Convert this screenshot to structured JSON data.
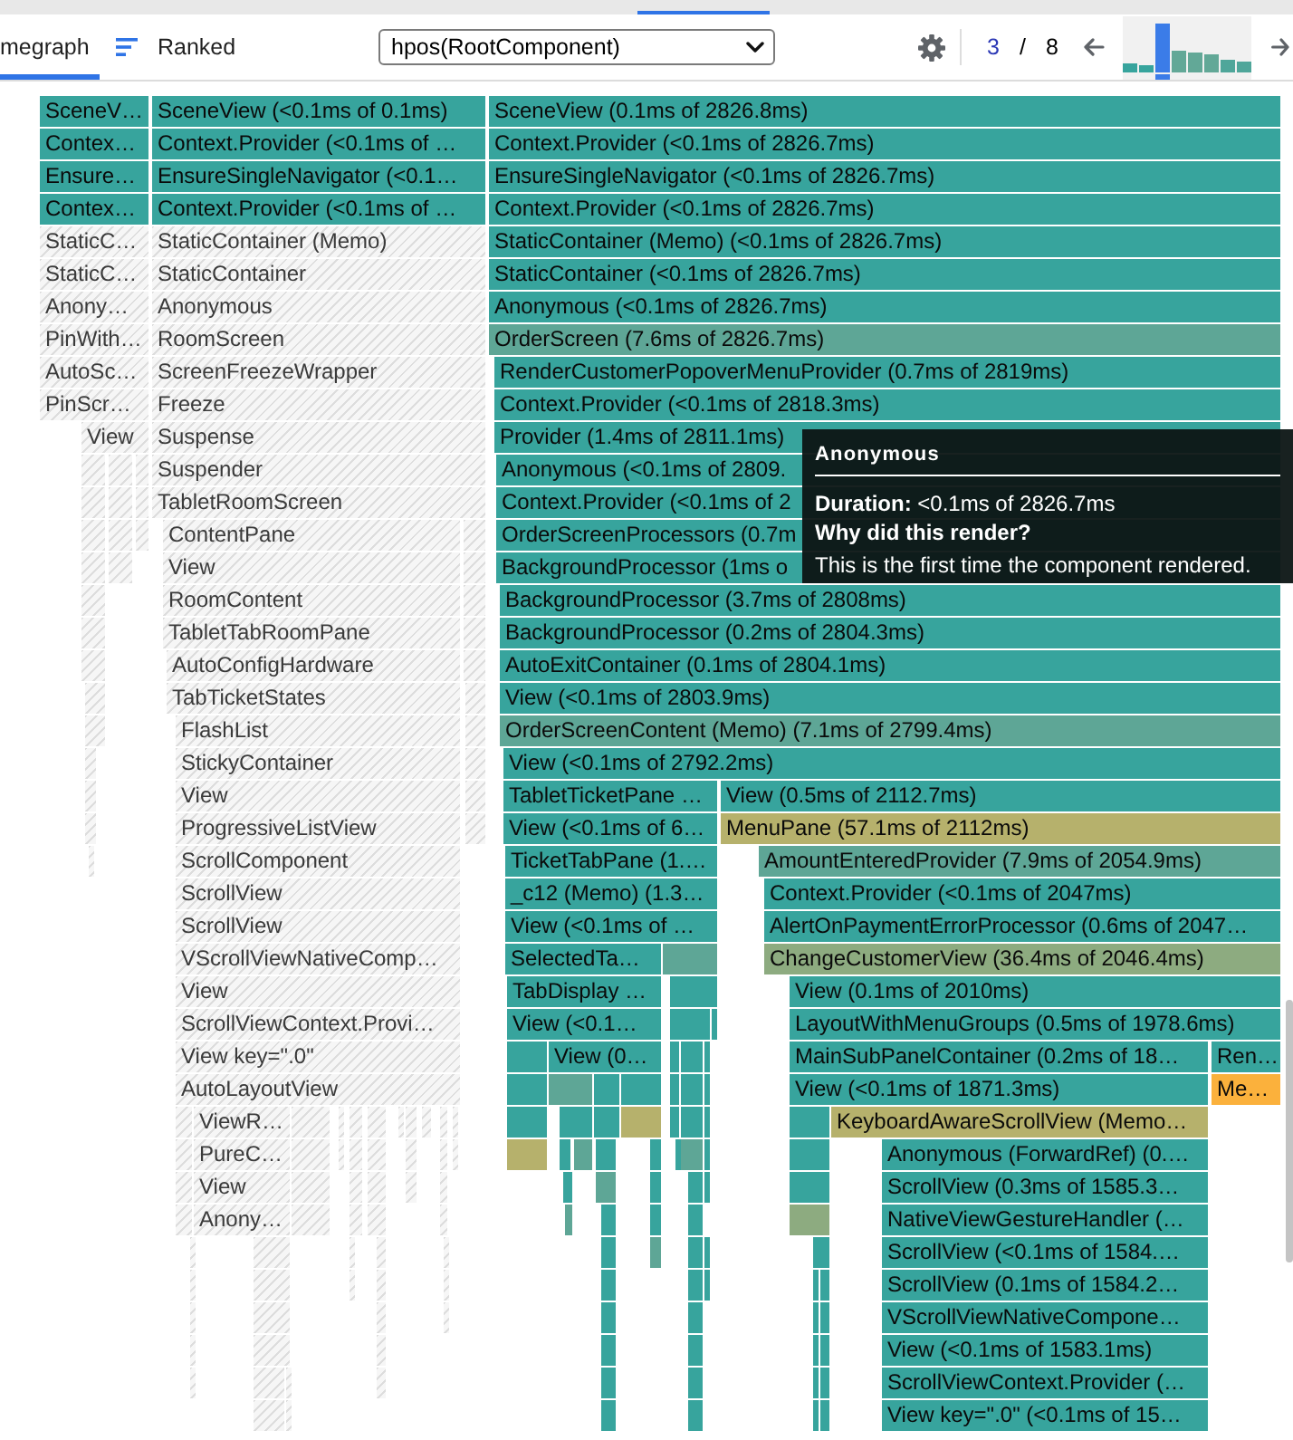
{
  "toolbar": {
    "tabs": [
      {
        "kind": "flamegraph",
        "label": "megraph",
        "selected": true
      },
      {
        "kind": "ranked",
        "label": "Ranked",
        "selected": false
      }
    ],
    "root_select": {
      "value": "hpos(RootComponent)"
    },
    "commit_nav": {
      "current": "3",
      "separator": "/",
      "total": "8"
    },
    "commits": [
      {
        "selected": false,
        "color": "#37a49d"
      },
      {
        "selected": false,
        "color": "#37a49d"
      },
      {
        "selected": true
      },
      {
        "selected": false,
        "color": "#62a897"
      },
      {
        "selected": false,
        "color": "#62a897"
      },
      {
        "selected": false,
        "color": "#62a897"
      },
      {
        "selected": false,
        "color": "#4fa69a"
      },
      {
        "selected": false,
        "color": "#4fa69a"
      }
    ]
  },
  "flamegraph": {
    "rows": [
      {
        "bars": [
          {
            "label": "SceneV…",
            "rendered": true,
            "color": "#37a49d"
          },
          {
            "label": "SceneView (<0.1ms of 0.1ms)",
            "rendered": true,
            "color": "#37a49d"
          },
          {
            "label": "SceneView (0.1ms of 2826.8ms)",
            "rendered": true,
            "color": "#37a49d"
          }
        ]
      },
      {
        "bars": [
          {
            "label": "Contex…",
            "rendered": true,
            "color": "#37a49d"
          },
          {
            "label": "Context.Provider (<0.1ms of …",
            "rendered": true,
            "color": "#37a49d"
          },
          {
            "label": "Context.Provider (<0.1ms of 2826.7ms)",
            "rendered": true,
            "color": "#37a49d"
          }
        ]
      },
      {
        "bars": [
          {
            "label": "Ensure…",
            "rendered": true,
            "color": "#37a49d"
          },
          {
            "label": "EnsureSingleNavigator (<0.1…",
            "rendered": true,
            "color": "#37a49d"
          },
          {
            "label": "EnsureSingleNavigator (<0.1ms of 2826.7ms)",
            "rendered": true,
            "color": "#37a49d"
          }
        ]
      },
      {
        "bars": [
          {
            "label": "Contex…",
            "rendered": true,
            "color": "#37a49d"
          },
          {
            "label": "Context.Provider (<0.1ms of …",
            "rendered": true,
            "color": "#37a49d"
          },
          {
            "label": "Context.Provider (<0.1ms of 2826.7ms)",
            "rendered": true,
            "color": "#37a49d"
          }
        ]
      },
      {
        "bars": [
          {
            "label": "StaticC…",
            "rendered": false
          },
          {
            "label": "StaticContainer (Memo)",
            "rendered": false
          },
          {
            "label": "StaticContainer (Memo) (<0.1ms of 2826.7ms)",
            "rendered": true,
            "color": "#37a49d"
          }
        ]
      },
      {
        "bars": [
          {
            "label": "StaticC…",
            "rendered": false
          },
          {
            "label": "StaticContainer",
            "rendered": false
          },
          {
            "label": "StaticContainer (<0.1ms of 2826.7ms)",
            "rendered": true,
            "color": "#37a49d"
          }
        ]
      },
      {
        "bars": [
          {
            "label": "Anony…",
            "rendered": false
          },
          {
            "label": "Anonymous",
            "rendered": false
          },
          {
            "label": "Anonymous (<0.1ms of 2826.7ms)",
            "rendered": true,
            "color": "#37a49d"
          }
        ]
      },
      {
        "bars": [
          {
            "label": "PinWith…",
            "rendered": false
          },
          {
            "label": "RoomScreen",
            "rendered": false
          },
          {
            "label": "OrderScreen (7.6ms of 2826.7ms)",
            "rendered": true,
            "color": "#5ea696"
          }
        ]
      },
      {
        "bars": [
          {
            "label": "AutoSc…",
            "rendered": false
          },
          {
            "label": "ScreenFreezeWrapper",
            "rendered": false
          },
          {
            "label": "RenderCustomerPopoverMenuProvider (0.7ms of 2819ms)",
            "rendered": true,
            "color": "#37a49d"
          }
        ]
      },
      {
        "bars": [
          {
            "label": "PinScr…",
            "rendered": false
          },
          {
            "label": "Freeze",
            "rendered": false
          },
          {
            "label": "Context.Provider (<0.1ms of 2818.3ms)",
            "rendered": true,
            "color": "#37a49d"
          }
        ]
      },
      {
        "bars": [
          {
            "label": "View",
            "rendered": false
          },
          {
            "label": "Suspense",
            "rendered": false
          },
          {
            "label": "Provider (1.4ms of 2811.1ms)",
            "rendered": true,
            "color": "#37a49d"
          }
        ]
      },
      {
        "bars": [
          {
            "rendered": false
          },
          {
            "rendered": false
          },
          {
            "rendered": false
          },
          {
            "label": "Suspender",
            "rendered": false
          },
          {
            "label": "Anonymous (<0.1ms of 2809.",
            "rendered": true,
            "color": "#37a49d"
          }
        ]
      },
      {
        "bars": [
          {
            "rendered": false
          },
          {
            "rendered": false
          },
          {
            "rendered": false
          },
          {
            "label": "TabletRoomScreen",
            "rendered": false
          },
          {
            "label": "Context.Provider (<0.1ms of 2",
            "rendered": true,
            "color": "#37a49d"
          }
        ]
      },
      {
        "bars": [
          {
            "rendered": false
          },
          {
            "rendered": false
          },
          {
            "rendered": false
          },
          {
            "label": "ContentPane",
            "rendered": false
          },
          {
            "rendered": false
          },
          {
            "label": "OrderScreenProcessors (0.7m",
            "rendered": true,
            "color": "#37a49d"
          }
        ]
      },
      {
        "bars": [
          {
            "rendered": false
          },
          {
            "rendered": false
          },
          {
            "label": "View",
            "rendered": false
          },
          {
            "rendered": false
          },
          {
            "label": "BackgroundProcessor (1ms o",
            "rendered": true,
            "color": "#37a49d"
          }
        ]
      },
      {
        "bars": [
          {
            "rendered": false
          },
          {
            "label": "RoomContent",
            "rendered": false
          },
          {
            "rendered": false
          },
          {
            "label": "BackgroundProcessor (3.7ms of 2808ms)",
            "rendered": true,
            "color": "#37a49d"
          }
        ]
      },
      {
        "bars": [
          {
            "rendered": false
          },
          {
            "label": "TabletTabRoomPane",
            "rendered": false
          },
          {
            "rendered": false
          },
          {
            "label": "BackgroundProcessor (0.2ms of 2804.3ms)",
            "rendered": true,
            "color": "#37a49d"
          }
        ]
      },
      {
        "bars": [
          {
            "rendered": false
          },
          {
            "label": "AutoConfigHardware",
            "rendered": false
          },
          {
            "rendered": false
          },
          {
            "label": "AutoExitContainer (0.1ms of 2804.1ms)",
            "rendered": true,
            "color": "#37a49d"
          }
        ]
      },
      {
        "bars": [
          {
            "rendered": false
          },
          {
            "label": "TabTicketStates",
            "rendered": false
          },
          {
            "rendered": false
          },
          {
            "label": "View (<0.1ms of 2803.9ms)",
            "rendered": true,
            "color": "#37a49d"
          }
        ]
      },
      {
        "bars": [
          {
            "rendered": false
          },
          {
            "label": "FlashList",
            "rendered": false
          },
          {
            "rendered": false
          },
          {
            "label": "OrderScreenContent (Memo) (7.1ms of 2799.4ms)",
            "rendered": true,
            "color": "#5ea696"
          }
        ]
      },
      {
        "bars": [
          {
            "rendered": false
          },
          {
            "label": "StickyContainer",
            "rendered": false
          },
          {
            "rendered": false
          },
          {
            "label": "View (<0.1ms of 2792.2ms)",
            "rendered": true,
            "color": "#37a49d"
          }
        ]
      },
      {
        "bars": [
          {
            "rendered": false
          },
          {
            "label": "View",
            "rendered": false
          },
          {
            "rendered": false
          },
          {
            "label": "TabletTicketPane …",
            "rendered": true,
            "color": "#37a49d"
          },
          {
            "label": "View (0.5ms of 2112.7ms)",
            "rendered": true,
            "color": "#37a49d"
          }
        ]
      },
      {
        "bars": [
          {
            "rendered": false
          },
          {
            "label": "ProgressiveListView",
            "rendered": false
          },
          {
            "rendered": false
          },
          {
            "label": "View (<0.1ms of 6…",
            "rendered": true,
            "color": "#37a49d"
          },
          {
            "label": "MenuPane (57.1ms of 2112ms)",
            "rendered": true,
            "color": "#b6b16c"
          }
        ]
      },
      {
        "bars": [
          {
            "rendered": false
          },
          {
            "label": "ScrollComponent",
            "rendered": false
          },
          {
            "label": "TicketTabPane (1.…",
            "rendered": true,
            "color": "#37a49d"
          },
          {
            "label": "AmountEnteredProvider (7.9ms of 2054.9ms)",
            "rendered": true,
            "color": "#5ea696"
          }
        ]
      },
      {
        "bars": [
          {
            "label": "ScrollView",
            "rendered": false
          },
          {
            "label": "_c12 (Memo) (1.3…",
            "rendered": true,
            "color": "#37a49d"
          },
          {
            "label": "Context.Provider (<0.1ms of 2047ms)",
            "rendered": true,
            "color": "#37a49d"
          }
        ]
      },
      {
        "bars": [
          {
            "label": "ScrollView",
            "rendered": false
          },
          {
            "label": "View (<0.1ms of …",
            "rendered": true,
            "color": "#37a49d"
          },
          {
            "label": "AlertOnPaymentErrorProcessor (0.6ms of 2047…",
            "rendered": true,
            "color": "#37a49d"
          }
        ]
      },
      {
        "bars": [
          {
            "label": "VScrollViewNativeComp…",
            "rendered": false
          },
          {
            "label": "SelectedTa…",
            "rendered": true,
            "color": "#37a49d"
          },
          {
            "rendered": true,
            "color": "#5ea696"
          },
          {
            "label": "ChangeCustomerView (36.4ms of 2046.4ms)",
            "rendered": true,
            "color": "#8dab80"
          }
        ]
      },
      {
        "bars": [
          {
            "label": "View",
            "rendered": false
          },
          {
            "label": "TabDisplay …",
            "rendered": true,
            "color": "#37a49d"
          },
          {
            "rendered": true,
            "color": "#37a49d"
          },
          {
            "label": "View (0.1ms of 2010ms)",
            "rendered": true,
            "color": "#37a49d"
          }
        ]
      },
      {
        "bars": [
          {
            "label": "ScrollViewContext.Provi…",
            "rendered": false
          },
          {
            "label": "View (<0.1…",
            "rendered": true,
            "color": "#37a49d"
          },
          {
            "rendered": true,
            "color": "#37a49d"
          },
          {
            "rendered": true,
            "color": "#37a49d"
          },
          {
            "label": "LayoutWithMenuGroups (0.5ms of 1978.6ms)",
            "rendered": true,
            "color": "#37a49d"
          }
        ]
      },
      {
        "bars": [
          {
            "label": "View key=\".0\"",
            "rendered": false
          },
          {
            "rendered": true,
            "color": "#37a49d"
          },
          {
            "label": "View (0…",
            "rendered": true,
            "color": "#37a49d"
          },
          {
            "rendered": true,
            "color": "#37a49d"
          },
          {
            "rendered": true,
            "color": "#37a49d"
          },
          {
            "rendered": true,
            "color": "#37a49d"
          },
          {
            "label": "MainSubPanelContainer (0.2ms of 18…",
            "rendered": true,
            "color": "#37a49d"
          },
          {
            "label": "Ren…",
            "rendered": true,
            "color": "#37a49d"
          }
        ]
      },
      {
        "bars": [
          {
            "label": "AutoLayoutView",
            "rendered": false
          },
          {
            "rendered": true,
            "color": "#37a49d"
          },
          {
            "rendered": true,
            "color": "#5ea696"
          },
          {
            "rendered": true,
            "color": "#37a49d"
          },
          {
            "rendered": true,
            "color": "#37a49d"
          },
          {
            "rendered": true,
            "color": "#37a49d"
          },
          {
            "rendered": true,
            "color": "#37a49d"
          },
          {
            "rendered": true,
            "color": "#37a49d"
          },
          {
            "label": "View (<0.1ms of 1871.3ms)",
            "rendered": true,
            "color": "#37a49d"
          },
          {
            "label": "Me…",
            "rendered": true,
            "color": "#fbb13c"
          }
        ]
      },
      {
        "bars": [
          {
            "rendered": false
          },
          {
            "label": "ViewR…",
            "rendered": false
          },
          {
            "rendered": false
          },
          {
            "rendered": false
          },
          {
            "rendered": false
          },
          {
            "rendered": false
          },
          {
            "rendered": false
          },
          {
            "rendered": false
          },
          {
            "rendered": false
          },
          {
            "rendered": false
          },
          {
            "rendered": false
          },
          {
            "rendered": true,
            "color": "#37a49d"
          },
          {
            "rendered": true,
            "color": "#37a49d"
          },
          {
            "rendered": true,
            "color": "#37a49d"
          },
          {
            "rendered": true,
            "color": "#b6b16c"
          },
          {
            "rendered": true,
            "color": "#37a49d"
          },
          {
            "rendered": true,
            "color": "#37a49d"
          },
          {
            "rendered": true,
            "color": "#37a49d"
          },
          {
            "rendered": true,
            "color": "#37a49d"
          },
          {
            "label": "KeyboardAwareScrollView (Memo…",
            "rendered": true,
            "color": "#b6b16c"
          }
        ]
      },
      {
        "bars": [
          {
            "rendered": false
          },
          {
            "label": "PureC…",
            "rendered": false
          },
          {
            "rendered": false
          },
          {
            "rendered": false
          },
          {
            "rendered": false
          },
          {
            "rendered": false
          },
          {
            "rendered": false
          },
          {
            "rendered": false
          },
          {
            "rendered": false
          },
          {
            "rendered": true,
            "color": "#b6b16c"
          },
          {
            "rendered": true,
            "color": "#37a49d"
          },
          {
            "rendered": true,
            "color": "#5ea696"
          },
          {
            "rendered": true,
            "color": "#37a49d"
          },
          {
            "rendered": true,
            "color": "#37a49d"
          },
          {
            "rendered": true,
            "color": "#37a49d"
          },
          {
            "rendered": true,
            "color": "#5ea696"
          },
          {
            "rendered": true,
            "color": "#37a49d"
          },
          {
            "rendered": true,
            "color": "#37a49d"
          },
          {
            "label": "Anonymous (ForwardRef) (0.…",
            "rendered": true,
            "color": "#37a49d"
          }
        ]
      },
      {
        "bars": [
          {
            "rendered": false
          },
          {
            "label": "View",
            "rendered": false
          },
          {
            "rendered": false
          },
          {
            "rendered": false
          },
          {
            "rendered": false
          },
          {
            "rendered": false
          },
          {
            "rendered": false
          },
          {
            "rendered": true,
            "color": "#37a49d"
          },
          {
            "rendered": true,
            "color": "#5ea696"
          },
          {
            "rendered": true,
            "color": "#37a49d"
          },
          {
            "rendered": true,
            "color": "#37a49d"
          },
          {
            "rendered": true,
            "color": "#37a49d"
          },
          {
            "rendered": true,
            "color": "#37a49d"
          },
          {
            "label": "ScrollView (0.3ms of 1585.3…",
            "rendered": true,
            "color": "#37a49d"
          }
        ]
      },
      {
        "bars": [
          {
            "rendered": false
          },
          {
            "label": "Anony…",
            "rendered": false
          },
          {
            "rendered": false
          },
          {
            "rendered": false
          },
          {
            "rendered": false
          },
          {
            "rendered": false
          },
          {
            "rendered": true,
            "color": "#5ea696"
          },
          {
            "rendered": true,
            "color": "#37a49d"
          },
          {
            "rendered": true,
            "color": "#37a49d"
          },
          {
            "rendered": true,
            "color": "#37a49d"
          },
          {
            "rendered": true,
            "color": "#8dab80"
          },
          {
            "label": "NativeViewGestureHandler (…",
            "rendered": true,
            "color": "#37a49d"
          }
        ]
      },
      {
        "bars": [
          {
            "rendered": false
          },
          {
            "rendered": false
          },
          {
            "rendered": false
          },
          {
            "rendered": false
          },
          {
            "rendered": false
          },
          {
            "rendered": true,
            "color": "#37a49d"
          },
          {
            "rendered": true,
            "color": "#5ea696"
          },
          {
            "rendered": true,
            "color": "#37a49d"
          },
          {
            "rendered": true,
            "color": "#37a49d"
          },
          {
            "rendered": true,
            "color": "#37a49d"
          },
          {
            "label": "ScrollView (<0.1ms of 1584.…",
            "rendered": true,
            "color": "#37a49d"
          }
        ]
      },
      {
        "bars": [
          {
            "rendered": false
          },
          {
            "rendered": false
          },
          {
            "rendered": false
          },
          {
            "rendered": false
          },
          {
            "rendered": false
          },
          {
            "rendered": true,
            "color": "#37a49d"
          },
          {
            "rendered": true,
            "color": "#37a49d"
          },
          {
            "rendered": true,
            "color": "#37a49d"
          },
          {
            "rendered": true,
            "color": "#37a49d"
          },
          {
            "rendered": true,
            "color": "#37a49d"
          },
          {
            "label": "ScrollView (0.1ms of 1584.2…",
            "rendered": true,
            "color": "#37a49d"
          }
        ]
      },
      {
        "bars": [
          {
            "rendered": false
          },
          {
            "rendered": false
          },
          {
            "rendered": false
          },
          {
            "rendered": false
          },
          {
            "rendered": true,
            "color": "#37a49d"
          },
          {
            "rendered": true,
            "color": "#37a49d"
          },
          {
            "rendered": true,
            "color": "#37a49d"
          },
          {
            "rendered": true,
            "color": "#37a49d"
          },
          {
            "label": "VScrollViewNativeCompone…",
            "rendered": true,
            "color": "#37a49d"
          }
        ]
      },
      {
        "bars": [
          {
            "rendered": false
          },
          {
            "rendered": false
          },
          {
            "rendered": false
          },
          {
            "rendered": true,
            "color": "#37a49d"
          },
          {
            "rendered": true,
            "color": "#37a49d"
          },
          {
            "rendered": true,
            "color": "#37a49d"
          },
          {
            "rendered": true,
            "color": "#37a49d"
          },
          {
            "label": "View (<0.1ms of 1583.1ms)",
            "rendered": true,
            "color": "#37a49d"
          }
        ]
      },
      {
        "bars": [
          {
            "rendered": false
          },
          {
            "rendered": false
          },
          {
            "rendered": false
          },
          {
            "rendered": false
          },
          {
            "rendered": true,
            "color": "#37a49d"
          },
          {
            "rendered": true,
            "color": "#37a49d"
          },
          {
            "rendered": true,
            "color": "#37a49d"
          },
          {
            "rendered": true,
            "color": "#37a49d"
          },
          {
            "label": "ScrollViewContext.Provider (…",
            "rendered": true,
            "color": "#37a49d"
          }
        ]
      },
      {
        "bars": [
          {
            "rendered": false
          },
          {
            "rendered": false
          },
          {
            "rendered": true,
            "color": "#37a49d"
          },
          {
            "rendered": true,
            "color": "#37a49d"
          },
          {
            "rendered": true,
            "color": "#37a49d"
          },
          {
            "rendered": true,
            "color": "#37a49d"
          },
          {
            "label": "View key=\".0\" (<0.1ms of 15…",
            "rendered": true,
            "color": "#37a49d"
          }
        ]
      }
    ]
  },
  "tooltip": {
    "title": "Anonymous",
    "duration": "**Duration:** <0.1ms of 2826.7ms",
    "question": "Why did this render?",
    "answer": "This is the first time the component rendered."
  }
}
